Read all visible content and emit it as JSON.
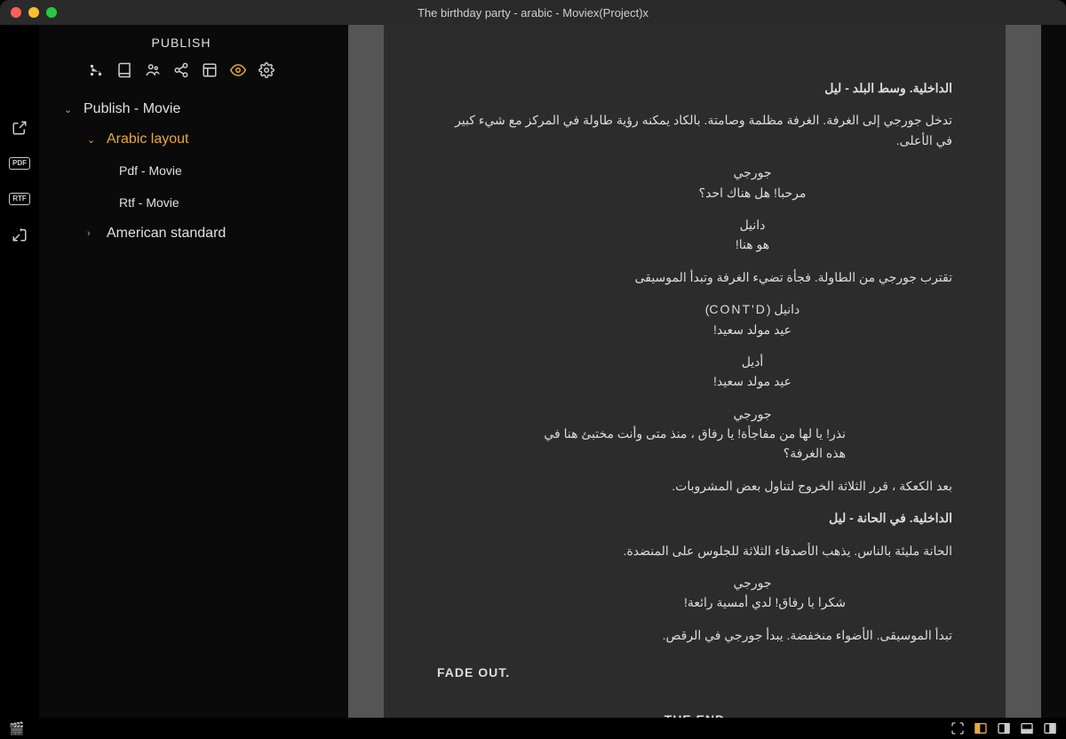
{
  "window": {
    "title": "The birthday party - arabic - Moviex(Project)x"
  },
  "sidebar": {
    "header": "PUBLISH",
    "tree": {
      "root": {
        "label": "Publish - Movie",
        "expanded": true
      },
      "arabic": {
        "label": "Arabic layout",
        "expanded": true,
        "selected": true
      },
      "pdf": {
        "label": "Pdf - Movie"
      },
      "rtf": {
        "label": "Rtf - Movie"
      },
      "american": {
        "label": "American standard",
        "expanded": false
      }
    }
  },
  "leftRail": {
    "pdfLabel": "PDF",
    "rtfLabel": "RTF"
  },
  "screenplay": {
    "scene1": "الداخلية. وسط البلد - ليل",
    "action1": "تدخل جورجي إلى الغرفة. الغرفة مظلمة وصامتة. بالكاد يمكنه رؤية طاولة في المركز مع شيء كبير في الأعلى.",
    "char1": "جورجي",
    "dialog1": "مرحبا! هل هناك احد؟",
    "char2": "دانيل",
    "dialog2": "هو هنا!",
    "action2": "تقترب جورجي من الطاولة. فجأة تضيء الغرفة وتبدأ الموسيقى",
    "char3": "دانيل (CONT'D)",
    "dialog3": "عيد مولد سعيد!",
    "char4": "أديل",
    "dialog4": "عيد مولد سعيد!",
    "char5": "جورجي",
    "dialog5": "نذر! يا لها من مفاجأة! يا رفاق ، منذ متى وأنت مختبئ هنا في هذه الغرفة؟",
    "action3": "بعد الكعكة ، قرر الثلاثة الخروج لتناول بعض المشروبات.",
    "scene2": "الداخلية. في الحانة - ليل",
    "action4": "الحانة مليئة بالناس. يذهب الأصدقاء الثلاثة للجلوس على المنضدة.",
    "char6": "جورجي",
    "dialog6": "شكرا يا رفاق! لدي أمسية رائعة!",
    "action5": "تبدأ الموسيقى. الأضواء منخفضة. يبدأ جورجي في الرقص.",
    "transition": "FADE OUT.",
    "end": "THE END"
  }
}
